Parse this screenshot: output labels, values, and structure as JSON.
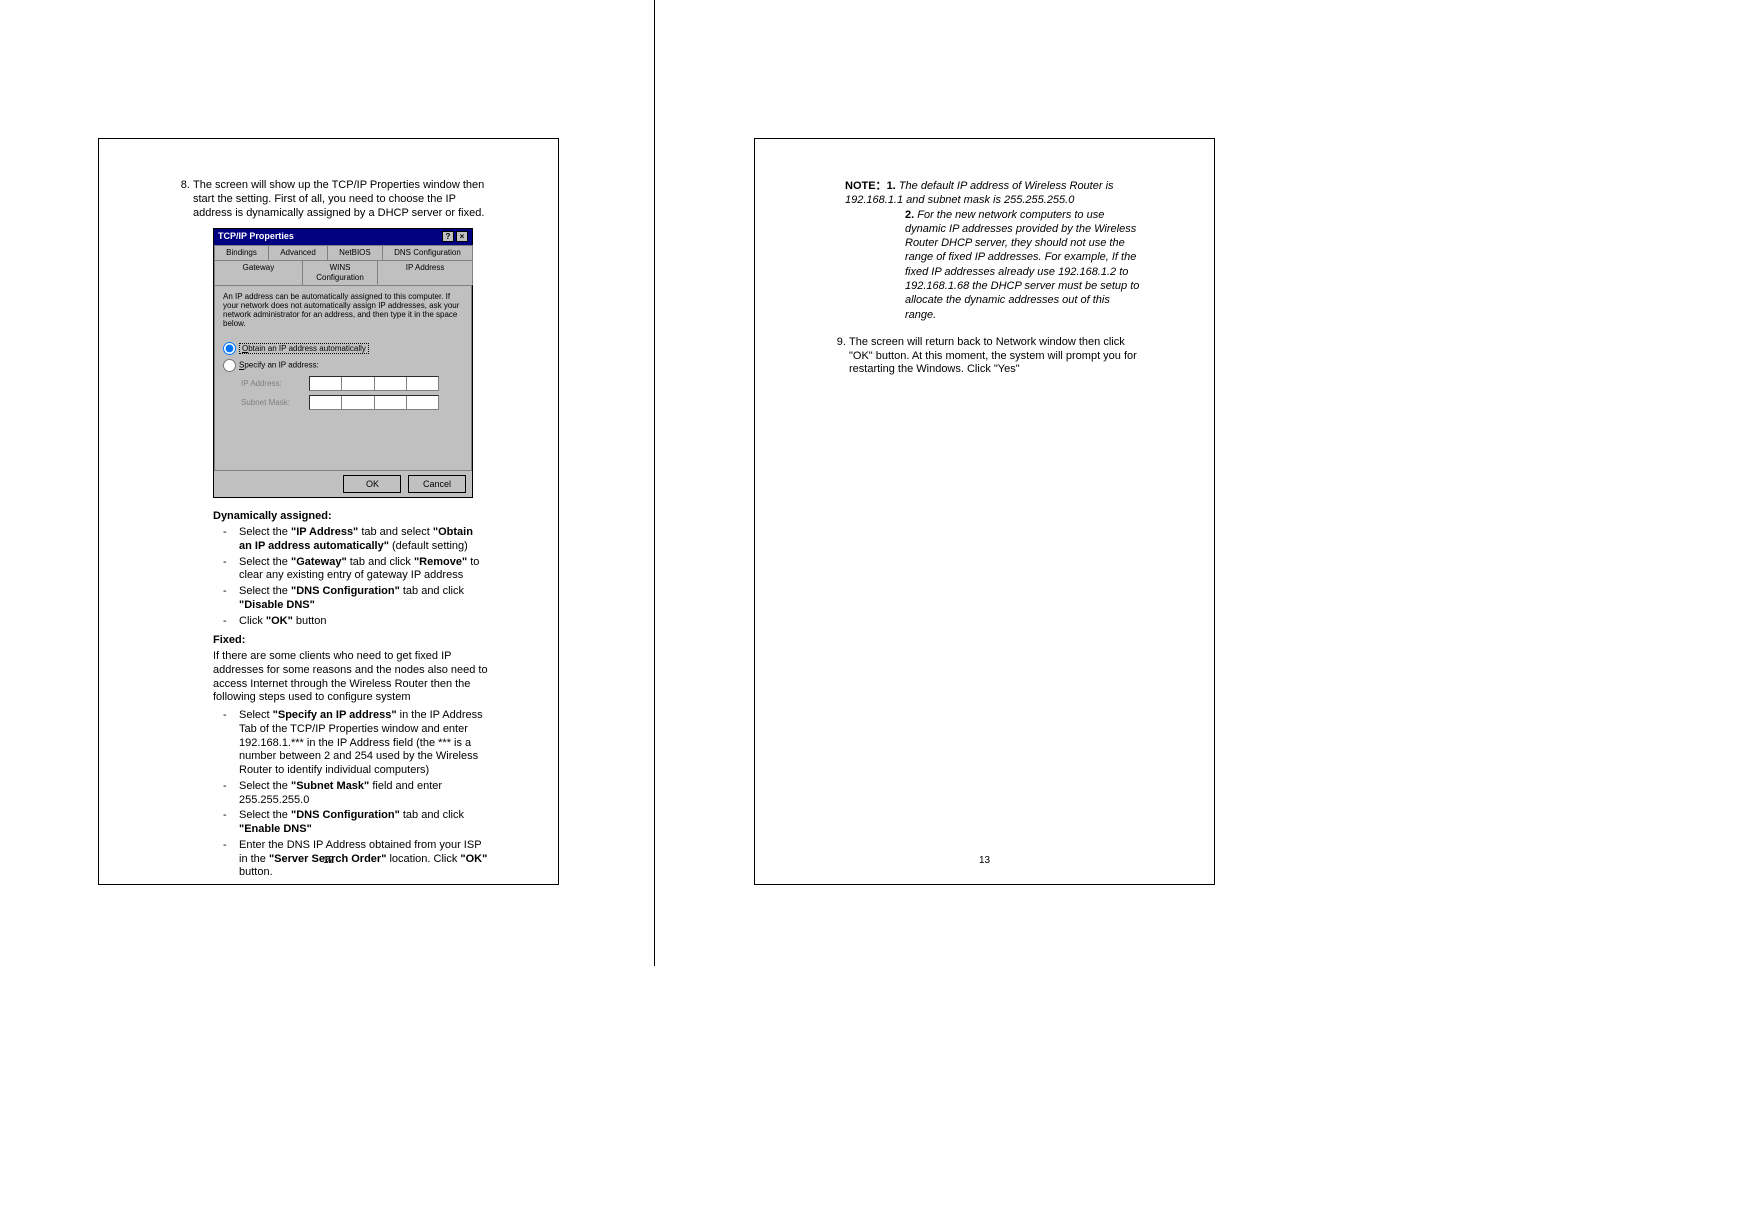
{
  "left": {
    "step8": "The screen will show up the TCP/IP Properties window then start the setting. First of all, you need to choose the IP address is dynamically assigned by a DHCP server or fixed.",
    "dialog": {
      "title": "TCP/IP Properties",
      "help_btn": "?",
      "close_btn": "×",
      "tabs_top": [
        "Bindings",
        "Advanced",
        "NetBIOS",
        "DNS Configuration"
      ],
      "tabs_bottom": [
        "Gateway",
        "WINS Configuration",
        "IP Address"
      ],
      "desc": "An IP address can be automatically assigned to this computer. If your network does not automatically assign IP addresses, ask your network administrator for an address, and then type it in the space below.",
      "radio1": "Obtain an IP address automatically",
      "radio2": "Specify an IP address:",
      "ip_label": "IP Address:",
      "mask_label": "Subnet Mask:",
      "ok": "OK",
      "cancel": "Cancel"
    },
    "dyn_head": "Dynamically assigned:",
    "dyn_items": [
      "Select the <b>\"IP Address\"</b> tab and select <b>\"Obtain an IP address automatically\"</b> (default setting)",
      "Select the <b>\"Gateway\"</b> tab and click <b>\"Remove\"</b> to clear any existing entry of gateway IP address",
      "Select the <b>\"DNS Configuration\"</b> tab and click <b>\"Disable DNS\"</b>",
      "Click <b>\"OK\"</b> button"
    ],
    "fixed_head": "Fixed:",
    "fixed_para": "If there are some clients who need to get fixed IP addresses for some reasons and the nodes also need to access Internet through the Wireless Router then the following steps used to configure system",
    "fixed_items": [
      "Select <b>\"Specify an IP address\"</b> in the IP Address Tab of the TCP/IP Properties window and enter 192.168.1.*** in the IP Address field (the *** is a number between 2 and 254 used by the Wireless Router to identify individual computers)",
      "Select the <b>\"Subnet Mask\"</b> field and enter 255.255.255.0",
      "Select the <b>\"DNS Configuration\"</b> tab and click <b>\"Enable DNS\"</b>",
      "Enter the DNS IP Address obtained from your ISP in the <b>\"Server Search Order\"</b> location. Click <b>\"OK\"</b> button."
    ],
    "pagenum": "12"
  },
  "right": {
    "note_label": "NOTE：",
    "note1_num": "1.",
    "note1": "The default IP address of Wireless Router is 192.168.1.1 and subnet mask is 255.255.255.0",
    "note2_num": "2.",
    "note2": "For the new network computers to use dynamic IP addresses provided by the Wireless Router DHCP server, they should not use the range of fixed IP addresses. For example, If the fixed IP addresses already use 192.168.1.2 to 192.168.1.68 the DHCP server must be setup to allocate the dynamic addresses out of this range.",
    "step9": "The screen will return back to Network window then click \"OK\" button. At this moment, the system will prompt you for restarting the Windows. Click \"Yes\"",
    "pagenum": "13"
  }
}
